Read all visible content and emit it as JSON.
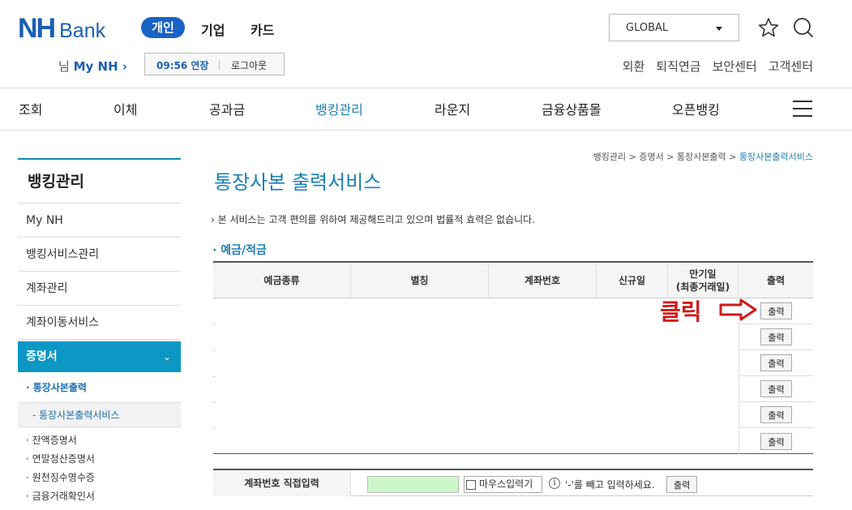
{
  "header": {
    "logo_nh": "NH",
    "logo_bank": "Bank",
    "tabs": [
      "개인",
      "기업",
      "카드"
    ],
    "global_select": "GLOBAL",
    "user_prefix": "님",
    "my_nh": "My NH ›",
    "session_time": "09:56 연장",
    "logout": "로그아웃",
    "util_links": [
      "외환",
      "퇴직연금",
      "보안센터",
      "고객센터"
    ]
  },
  "gnb": [
    "조회",
    "이체",
    "공과금",
    "뱅킹관리",
    "라운지",
    "금융상품몰",
    "오픈뱅킹"
  ],
  "sidebar": {
    "title": "뱅킹관리",
    "items": [
      "My NH",
      "뱅킹서비스관리",
      "계좌관리",
      "계좌이동서비스"
    ],
    "active": "증명서",
    "active_chevron": "⌄",
    "sub_active": "· 통장사본출력",
    "sub_active_child": "- 통장사본출력서비스",
    "sub_items": [
      "· 잔액증명서",
      "· 연말정산증명서",
      "· 원천징수영수증",
      "· 금융거래확인서"
    ]
  },
  "main": {
    "breadcrumb": [
      "뱅킹관리",
      "증명서",
      "통장사본출력"
    ],
    "breadcrumb_current": "통장사본출력서비스",
    "title": "통장사본 출력서비스",
    "notice": "› 본 서비스는 고객 편의를 위하여 제공해드리고 있으며 법률적 효력은 없습니다.",
    "section": "· 예금/적금",
    "table_headers": [
      "예금종류",
      "별칭",
      "계좌번호",
      "신규일",
      "만기일\n(최종거래일)",
      "출력"
    ],
    "print_buttons": [
      "출력",
      "출력",
      "출력",
      "출력",
      "출력",
      "출력"
    ],
    "click_label": "클릭",
    "direct_label": "계좌번호 직접입력",
    "mouse_input": "마우스입력기",
    "info_icon": "i",
    "hint": "'-'를 빼고 입력하세요.",
    "direct_button": "출력"
  },
  "colors": {
    "brand": "#1a5fb4",
    "accent": "#0c97c4",
    "highlight": "#d11a1a",
    "input_bg": "#ccf7c8"
  }
}
